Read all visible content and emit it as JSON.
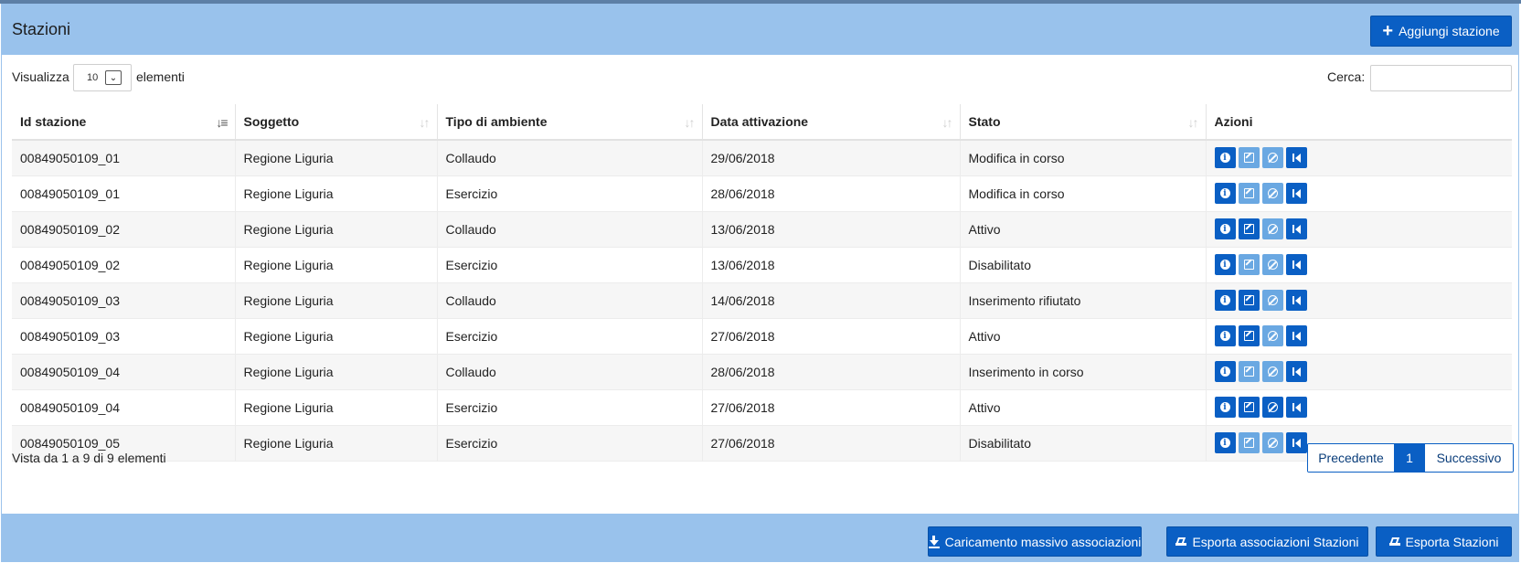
{
  "header": {
    "title": "Stazioni",
    "add_button": "Aggiungi stazione"
  },
  "controls": {
    "show_label": "Visualizza",
    "page_size": "10",
    "show_suffix": "elementi",
    "search_label": "Cerca:",
    "search_value": ""
  },
  "table": {
    "columns": [
      "Id stazione",
      "Soggetto",
      "Tipo di ambiente",
      "Data attivazione",
      "Stato",
      "Azioni"
    ],
    "rows": [
      {
        "id": "00849050109_01",
        "soggetto": "Regione Liguria",
        "tipo": "Collaudo",
        "data": "29/06/2018",
        "stato": "Modifica in corso",
        "actions": [
          true,
          false,
          false,
          true
        ]
      },
      {
        "id": "00849050109_01",
        "soggetto": "Regione Liguria",
        "tipo": "Esercizio",
        "data": "28/06/2018",
        "stato": "Modifica in corso",
        "actions": [
          true,
          false,
          false,
          true
        ]
      },
      {
        "id": "00849050109_02",
        "soggetto": "Regione Liguria",
        "tipo": "Collaudo",
        "data": "13/06/2018",
        "stato": "Attivo",
        "actions": [
          true,
          true,
          false,
          true
        ]
      },
      {
        "id": "00849050109_02",
        "soggetto": "Regione Liguria",
        "tipo": "Esercizio",
        "data": "13/06/2018",
        "stato": "Disabilitato",
        "actions": [
          true,
          false,
          false,
          true
        ]
      },
      {
        "id": "00849050109_03",
        "soggetto": "Regione Liguria",
        "tipo": "Collaudo",
        "data": "14/06/2018",
        "stato": "Inserimento rifiutato",
        "actions": [
          true,
          true,
          false,
          true
        ]
      },
      {
        "id": "00849050109_03",
        "soggetto": "Regione Liguria",
        "tipo": "Esercizio",
        "data": "27/06/2018",
        "stato": "Attivo",
        "actions": [
          true,
          true,
          false,
          true
        ]
      },
      {
        "id": "00849050109_04",
        "soggetto": "Regione Liguria",
        "tipo": "Collaudo",
        "data": "28/06/2018",
        "stato": "Inserimento in corso",
        "actions": [
          true,
          false,
          false,
          true
        ]
      },
      {
        "id": "00849050109_04",
        "soggetto": "Regione Liguria",
        "tipo": "Esercizio",
        "data": "27/06/2018",
        "stato": "Attivo",
        "actions": [
          true,
          true,
          true,
          true
        ]
      },
      {
        "id": "00849050109_05",
        "soggetto": "Regione Liguria",
        "tipo": "Esercizio",
        "data": "27/06/2018",
        "stato": "Disabilitato",
        "actions": [
          true,
          false,
          false,
          true
        ]
      }
    ]
  },
  "pagination": {
    "info": "Vista da 1 a 9 di 9 elementi",
    "prev": "Precedente",
    "current": "1",
    "next": "Successivo"
  },
  "footer": {
    "bulk_upload": "Caricamento massivo associazioni",
    "export_assoc": "Esporta associazioni Stazioni",
    "export_stations": "Esporta Stazioni"
  },
  "colors": {
    "primary": "#0a5fc4",
    "primary_light": "#6aa8e2",
    "panel": "#99c2ec"
  },
  "icons": [
    "plus-icon",
    "sort-icon",
    "info-icon",
    "edit-icon",
    "ban-icon",
    "first-page-icon",
    "download-icon",
    "export-icon",
    "chevron-down-icon"
  ]
}
